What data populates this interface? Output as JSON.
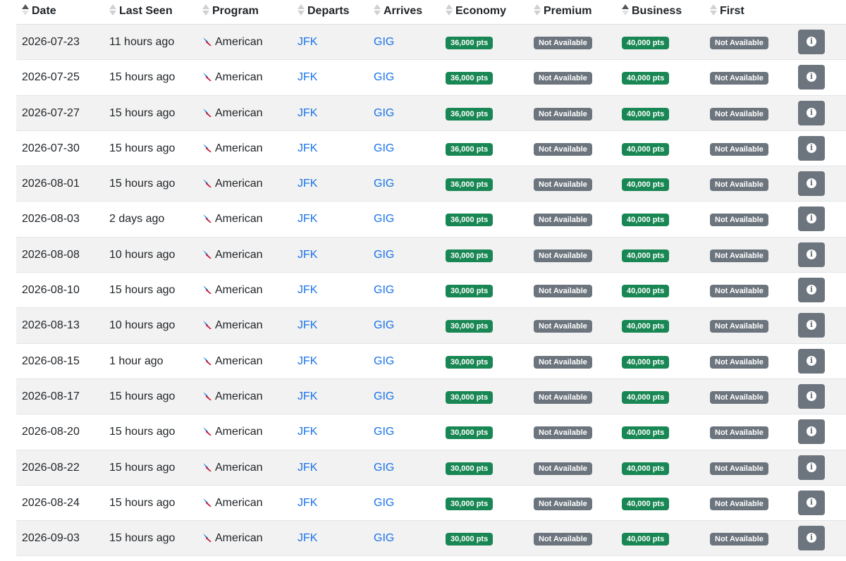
{
  "columns": [
    {
      "key": "date",
      "label": "Date",
      "sort": "asc"
    },
    {
      "key": "last_seen",
      "label": "Last Seen",
      "sort": "none"
    },
    {
      "key": "program",
      "label": "Program",
      "sort": "none"
    },
    {
      "key": "departs",
      "label": "Departs",
      "sort": "none"
    },
    {
      "key": "arrives",
      "label": "Arrives",
      "sort": "none"
    },
    {
      "key": "economy",
      "label": "Economy",
      "sort": "none"
    },
    {
      "key": "premium",
      "label": "Premium",
      "sort": "none"
    },
    {
      "key": "business",
      "label": "Business",
      "sort": "asc"
    },
    {
      "key": "first",
      "label": "First",
      "sort": "none"
    }
  ],
  "colors": {
    "available": "#198754",
    "not_available": "#6c757d",
    "link": "#1a73e8",
    "airline_red": "#c8102e",
    "airline_blue": "#0078d2"
  },
  "icons": {
    "program": "american-airlines-logo-icon",
    "info": "info-circle-icon",
    "sort": "sort-arrows-icon"
  },
  "rows": [
    {
      "date": "2026-07-23",
      "last_seen": "11 hours ago",
      "program": "American",
      "departs": "JFK",
      "arrives": "GIG",
      "economy": "36,000 pts",
      "premium": "Not Available",
      "business": "40,000 pts",
      "first": "Not Available"
    },
    {
      "date": "2026-07-25",
      "last_seen": "15 hours ago",
      "program": "American",
      "departs": "JFK",
      "arrives": "GIG",
      "economy": "36,000 pts",
      "premium": "Not Available",
      "business": "40,000 pts",
      "first": "Not Available"
    },
    {
      "date": "2026-07-27",
      "last_seen": "15 hours ago",
      "program": "American",
      "departs": "JFK",
      "arrives": "GIG",
      "economy": "36,000 pts",
      "premium": "Not Available",
      "business": "40,000 pts",
      "first": "Not Available"
    },
    {
      "date": "2026-07-30",
      "last_seen": "15 hours ago",
      "program": "American",
      "departs": "JFK",
      "arrives": "GIG",
      "economy": "36,000 pts",
      "premium": "Not Available",
      "business": "40,000 pts",
      "first": "Not Available"
    },
    {
      "date": "2026-08-01",
      "last_seen": "15 hours ago",
      "program": "American",
      "departs": "JFK",
      "arrives": "GIG",
      "economy": "36,000 pts",
      "premium": "Not Available",
      "business": "40,000 pts",
      "first": "Not Available"
    },
    {
      "date": "2026-08-03",
      "last_seen": "2 days ago",
      "program": "American",
      "departs": "JFK",
      "arrives": "GIG",
      "economy": "36,000 pts",
      "premium": "Not Available",
      "business": "40,000 pts",
      "first": "Not Available"
    },
    {
      "date": "2026-08-08",
      "last_seen": "10 hours ago",
      "program": "American",
      "departs": "JFK",
      "arrives": "GIG",
      "economy": "30,000 pts",
      "premium": "Not Available",
      "business": "40,000 pts",
      "first": "Not Available"
    },
    {
      "date": "2026-08-10",
      "last_seen": "15 hours ago",
      "program": "American",
      "departs": "JFK",
      "arrives": "GIG",
      "economy": "30,000 pts",
      "premium": "Not Available",
      "business": "40,000 pts",
      "first": "Not Available"
    },
    {
      "date": "2026-08-13",
      "last_seen": "10 hours ago",
      "program": "American",
      "departs": "JFK",
      "arrives": "GIG",
      "economy": "30,000 pts",
      "premium": "Not Available",
      "business": "40,000 pts",
      "first": "Not Available"
    },
    {
      "date": "2026-08-15",
      "last_seen": "1 hour ago",
      "program": "American",
      "departs": "JFK",
      "arrives": "GIG",
      "economy": "30,000 pts",
      "premium": "Not Available",
      "business": "40,000 pts",
      "first": "Not Available"
    },
    {
      "date": "2026-08-17",
      "last_seen": "15 hours ago",
      "program": "American",
      "departs": "JFK",
      "arrives": "GIG",
      "economy": "30,000 pts",
      "premium": "Not Available",
      "business": "40,000 pts",
      "first": "Not Available"
    },
    {
      "date": "2026-08-20",
      "last_seen": "15 hours ago",
      "program": "American",
      "departs": "JFK",
      "arrives": "GIG",
      "economy": "30,000 pts",
      "premium": "Not Available",
      "business": "40,000 pts",
      "first": "Not Available"
    },
    {
      "date": "2026-08-22",
      "last_seen": "15 hours ago",
      "program": "American",
      "departs": "JFK",
      "arrives": "GIG",
      "economy": "30,000 pts",
      "premium": "Not Available",
      "business": "40,000 pts",
      "first": "Not Available"
    },
    {
      "date": "2026-08-24",
      "last_seen": "15 hours ago",
      "program": "American",
      "departs": "JFK",
      "arrives": "GIG",
      "economy": "30,000 pts",
      "premium": "Not Available",
      "business": "40,000 pts",
      "first": "Not Available"
    },
    {
      "date": "2026-09-03",
      "last_seen": "15 hours ago",
      "program": "American",
      "departs": "JFK",
      "arrives": "GIG",
      "economy": "30,000 pts",
      "premium": "Not Available",
      "business": "40,000 pts",
      "first": "Not Available"
    }
  ]
}
